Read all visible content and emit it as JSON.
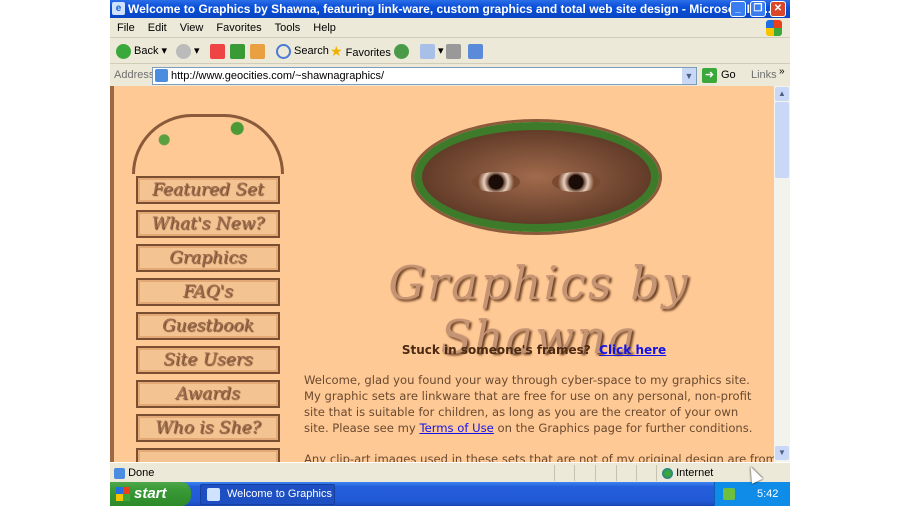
{
  "window": {
    "title": "Welcome to Graphics by Shawna, featuring link-ware, custom graphics and total web site design - Microsoft Int..."
  },
  "menu": [
    "File",
    "Edit",
    "View",
    "Favorites",
    "Tools",
    "Help"
  ],
  "toolbar": {
    "back": "Back",
    "search": "Search",
    "favorites": "Favorites"
  },
  "address": {
    "label": "Address",
    "url": "http://www.geocities.com/~shawnagraphics/",
    "go": "Go",
    "links": "Links"
  },
  "page": {
    "nav": [
      "Featured Set",
      "What's New?",
      "Graphics",
      "FAQ's",
      "Guestbook",
      "Site Users",
      "Awards",
      "Who is She?"
    ],
    "logo": "Graphics by Shawna",
    "stuck_text": "Stuck in someone's frames?",
    "stuck_link": "Click here",
    "welcome_1": "Welcome, glad you found your way through cyber-space to my graphics site.  My graphic sets are linkware that are free for use on any personal, non-profit site that is suitable for children, as long as you are the creator of your own site.  Please see my ",
    "terms_link": "Terms of Use",
    "welcome_2": " on the Graphics page for further conditions.",
    "more": "Any clip-art images used in these sets that are not of my original design are from"
  },
  "status": {
    "text": "Done",
    "zone": "Internet"
  },
  "taskbar": {
    "start": "start",
    "task": "Welcome to Graphics ...",
    "clock": "5:42 AM"
  }
}
